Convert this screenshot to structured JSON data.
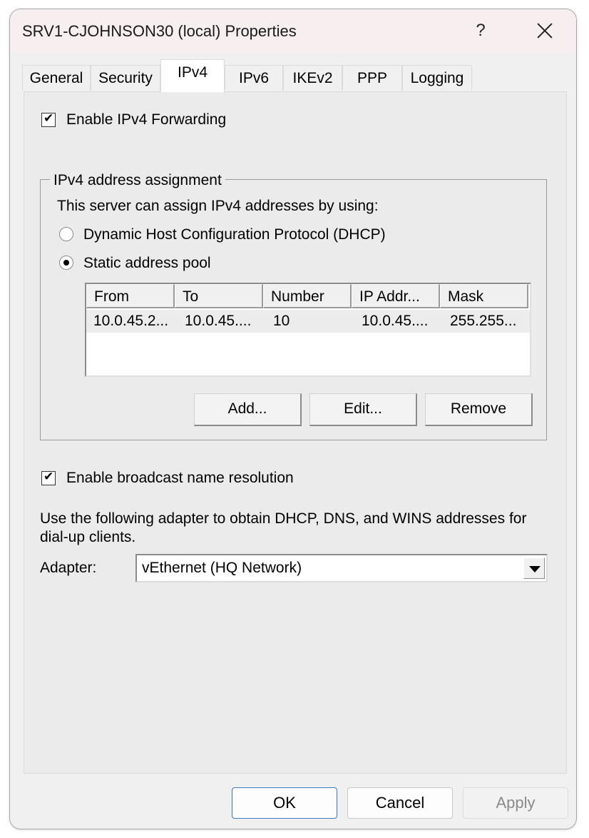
{
  "window": {
    "title": "SRV1-CJOHNSON30 (local) Properties",
    "help_label": "?"
  },
  "tabs": [
    {
      "label": "General"
    },
    {
      "label": "Security"
    },
    {
      "label": "IPv4"
    },
    {
      "label": "IPv6"
    },
    {
      "label": "IKEv2"
    },
    {
      "label": "PPP"
    },
    {
      "label": "Logging"
    }
  ],
  "active_tab": "IPv4",
  "ipv4": {
    "forwarding_label": "Enable IPv4 Forwarding",
    "forwarding_checked": true,
    "group_title": "IPv4 address assignment",
    "assign_intro": "This server can assign IPv4 addresses by using:",
    "dhcp_label": "Dynamic Host Configuration Protocol (DHCP)",
    "static_label": "Static address pool",
    "selected_option": "Static address pool",
    "pool_columns": [
      "From",
      "To",
      "Number",
      "IP Addr...",
      "Mask"
    ],
    "pool_rows": [
      [
        "10.0.45.2...",
        "10.0.45....",
        "10",
        "10.0.45....",
        "255.255..."
      ]
    ],
    "add_label": "Add...",
    "edit_label": "Edit...",
    "remove_label": "Remove",
    "broadcast_label": "Enable broadcast name resolution",
    "broadcast_checked": true,
    "adapter_note_line1": "Use the following adapter to obtain DHCP, DNS, and WINS addresses for",
    "adapter_note_line2": "dial-up clients.",
    "adapter_label": "Adapter:",
    "adapter_value": "vEthernet (HQ Network)"
  },
  "footer": {
    "ok_label": "OK",
    "cancel_label": "Cancel",
    "apply_label": "Apply"
  },
  "colors": {
    "titlebar": "#f7eef0",
    "primary_border": "#3b78c4",
    "panel": "#ebebeb"
  }
}
